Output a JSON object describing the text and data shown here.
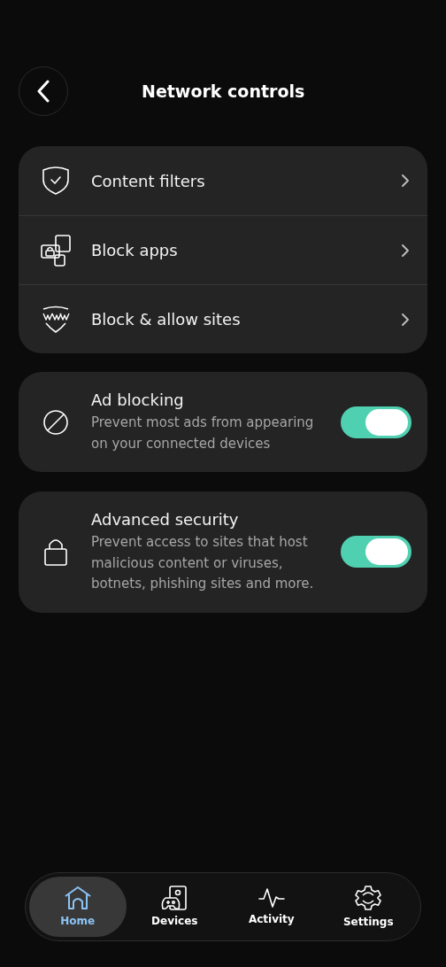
{
  "header": {
    "title": "Network controls"
  },
  "links": [
    {
      "label": "Content filters"
    },
    {
      "label": "Block apps"
    },
    {
      "label": "Block & allow sites"
    }
  ],
  "toggles": [
    {
      "title": "Ad blocking",
      "description": "Prevent most ads from appearing on your connected devices",
      "on": true
    },
    {
      "title": "Advanced security",
      "description": "Prevent access to sites that host malicious content or viruses, botnets, phishing sites and more.",
      "on": true
    }
  ],
  "nav": [
    {
      "label": "Home",
      "selected": true
    },
    {
      "label": "Devices",
      "selected": false
    },
    {
      "label": "Activity",
      "selected": false
    },
    {
      "label": "Settings",
      "selected": false
    }
  ]
}
